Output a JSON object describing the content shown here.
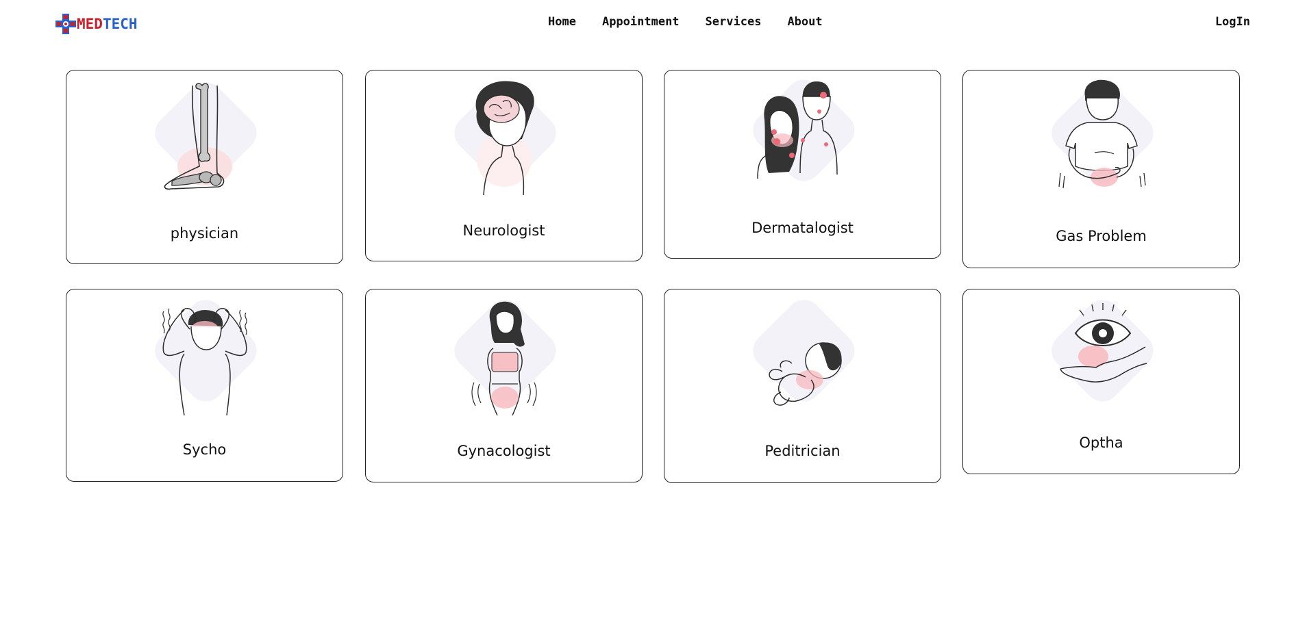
{
  "brand": {
    "name_part1": "MED",
    "name_part2": "TECH",
    "colors": {
      "red": "#c8202c",
      "blue": "#2761c9"
    }
  },
  "nav": {
    "items": [
      {
        "label": "Home"
      },
      {
        "label": "Appointment"
      },
      {
        "label": "Services"
      },
      {
        "label": "About"
      }
    ],
    "login_label": "LogIn"
  },
  "services": [
    {
      "label": "physician",
      "icon": "bone-leg-icon"
    },
    {
      "label": "Neurologist",
      "icon": "brain-head-icon"
    },
    {
      "label": "Dermatalogist",
      "icon": "skin-couple-icon"
    },
    {
      "label": "Gas Problem",
      "icon": "stomach-ache-icon"
    },
    {
      "label": "Sycho",
      "icon": "stressed-man-icon"
    },
    {
      "label": "Gynacologist",
      "icon": "woman-body-icon"
    },
    {
      "label": "Peditrician",
      "icon": "baby-icon"
    },
    {
      "label": "Optha",
      "icon": "eye-hand-icon"
    }
  ],
  "colors": {
    "accent_pink": "#f7b8bd",
    "accent_pink_dot": "#ec6a78",
    "halo": "#f1f1f8",
    "ink": "#2d2d2d"
  }
}
